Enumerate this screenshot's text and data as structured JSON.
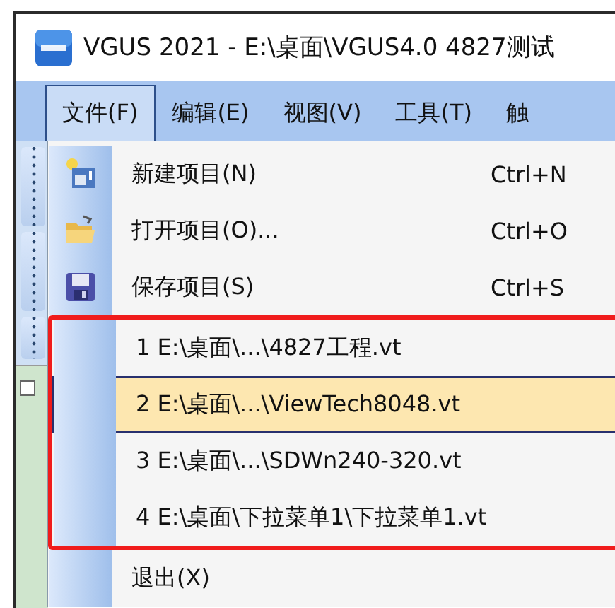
{
  "window": {
    "title": "VGUS 2021 - E:\\桌面\\VGUS4.0 4827测试"
  },
  "menu_bar": [
    {
      "label": "文件(F)",
      "selected": true
    },
    {
      "label": "编辑(E)",
      "selected": false
    },
    {
      "label": "视图(V)",
      "selected": false
    },
    {
      "label": "工具(T)",
      "selected": false
    },
    {
      "label": "触",
      "selected": false
    }
  ],
  "file_menu": {
    "items": [
      {
        "label": "新建项目(N)",
        "shortcut": "Ctrl+N"
      },
      {
        "label": "打开项目(O)...",
        "shortcut": "Ctrl+O"
      },
      {
        "label": "保存项目(S)",
        "shortcut": "Ctrl+S"
      }
    ],
    "recent_files": {
      "marked": true,
      "items": [
        {
          "label": "1 E:\\桌面\\...\\4827工程.vt",
          "selected": false
        },
        {
          "label": "2 E:\\桌面\\...\\ViewTech8048.vt",
          "selected": true
        },
        {
          "label": "3 E:\\桌面\\...\\SDWn240-320.vt",
          "selected": false
        },
        {
          "label": "4 E:\\桌面\\下拉菜单1\\下拉菜单1.vt",
          "selected": false
        }
      ]
    },
    "exit": {
      "label": "退出(X)"
    }
  }
}
